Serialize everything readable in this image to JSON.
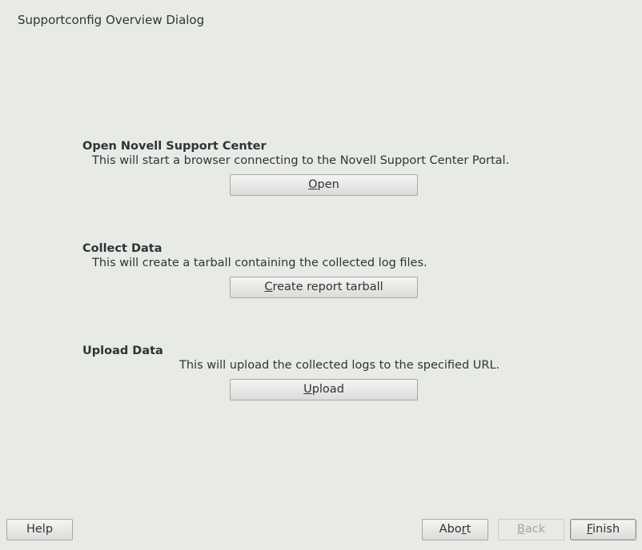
{
  "dialog": {
    "title": "Supportconfig Overview Dialog"
  },
  "sections": [
    {
      "heading": "Open Novell Support Center",
      "description": "This will start a browser connecting to the Novell Support Center Portal.",
      "button": {
        "mnemonic": "O",
        "rest": "pen"
      }
    },
    {
      "heading": "Collect Data",
      "description": "This will create a tarball containing the collected log files.",
      "button": {
        "mnemonic": "C",
        "rest": "reate report tarball"
      }
    },
    {
      "heading": "Upload Data",
      "description": "This will upload the collected logs to the specified URL.",
      "button": {
        "mnemonic": "U",
        "rest": "pload"
      }
    }
  ],
  "footer": {
    "help": "Help",
    "abort": {
      "pre": "Abo",
      "mnemonic": "r",
      "rest": "t"
    },
    "back": {
      "mnemonic": "B",
      "rest": "ack"
    },
    "finish": {
      "mnemonic": "F",
      "rest": "inish"
    }
  }
}
